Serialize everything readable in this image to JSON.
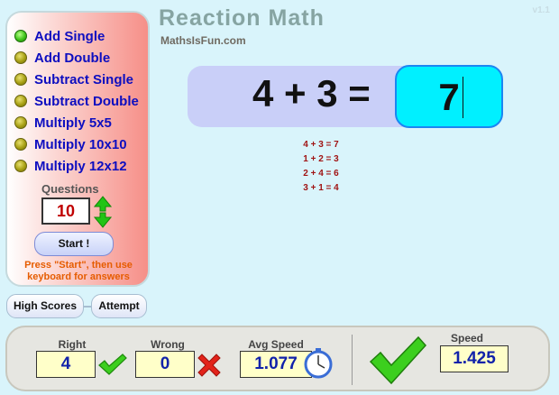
{
  "version": "v1.1",
  "app": {
    "title": "Reaction Math",
    "subtitle": "MathsIsFun.com"
  },
  "modes": [
    {
      "label": "Add Single",
      "selected": true
    },
    {
      "label": "Add Double",
      "selected": false
    },
    {
      "label": "Subtract Single",
      "selected": false
    },
    {
      "label": "Subtract Double",
      "selected": false
    },
    {
      "label": "Multiply 5x5",
      "selected": false
    },
    {
      "label": "Multiply 10x10",
      "selected": false
    },
    {
      "label": "Multiply 12x12",
      "selected": false
    }
  ],
  "questions": {
    "label": "Questions",
    "value": "10"
  },
  "start_button": "Start !",
  "hint": "Press \"Start\", then use keyboard for answers",
  "tabs": {
    "high_scores": "High Scores",
    "attempt": "Attempt"
  },
  "equation": {
    "question": "4 + 3 =",
    "answer": "7"
  },
  "history": [
    "4 + 3 = 7",
    "1 + 2 = 3",
    "2 + 4 = 6",
    "3 + 1 = 4"
  ],
  "stats": {
    "right_label": "Right",
    "right_value": "4",
    "wrong_label": "Wrong",
    "wrong_value": "0",
    "avg_label": "Avg Speed",
    "avg_value": "1.077",
    "speed_label": "Speed",
    "speed_value": "1.425"
  },
  "icons": {
    "check": "check-icon",
    "cross": "cross-icon",
    "clock": "clock-icon",
    "stepper": "up-down-arrows-icon"
  },
  "colors": {
    "mode_text": "#0d0ec0",
    "answer_bg": "#00f0ff",
    "history_text": "#a01414",
    "hint_text": "#e65c00",
    "stat_value": "#1122aa"
  }
}
